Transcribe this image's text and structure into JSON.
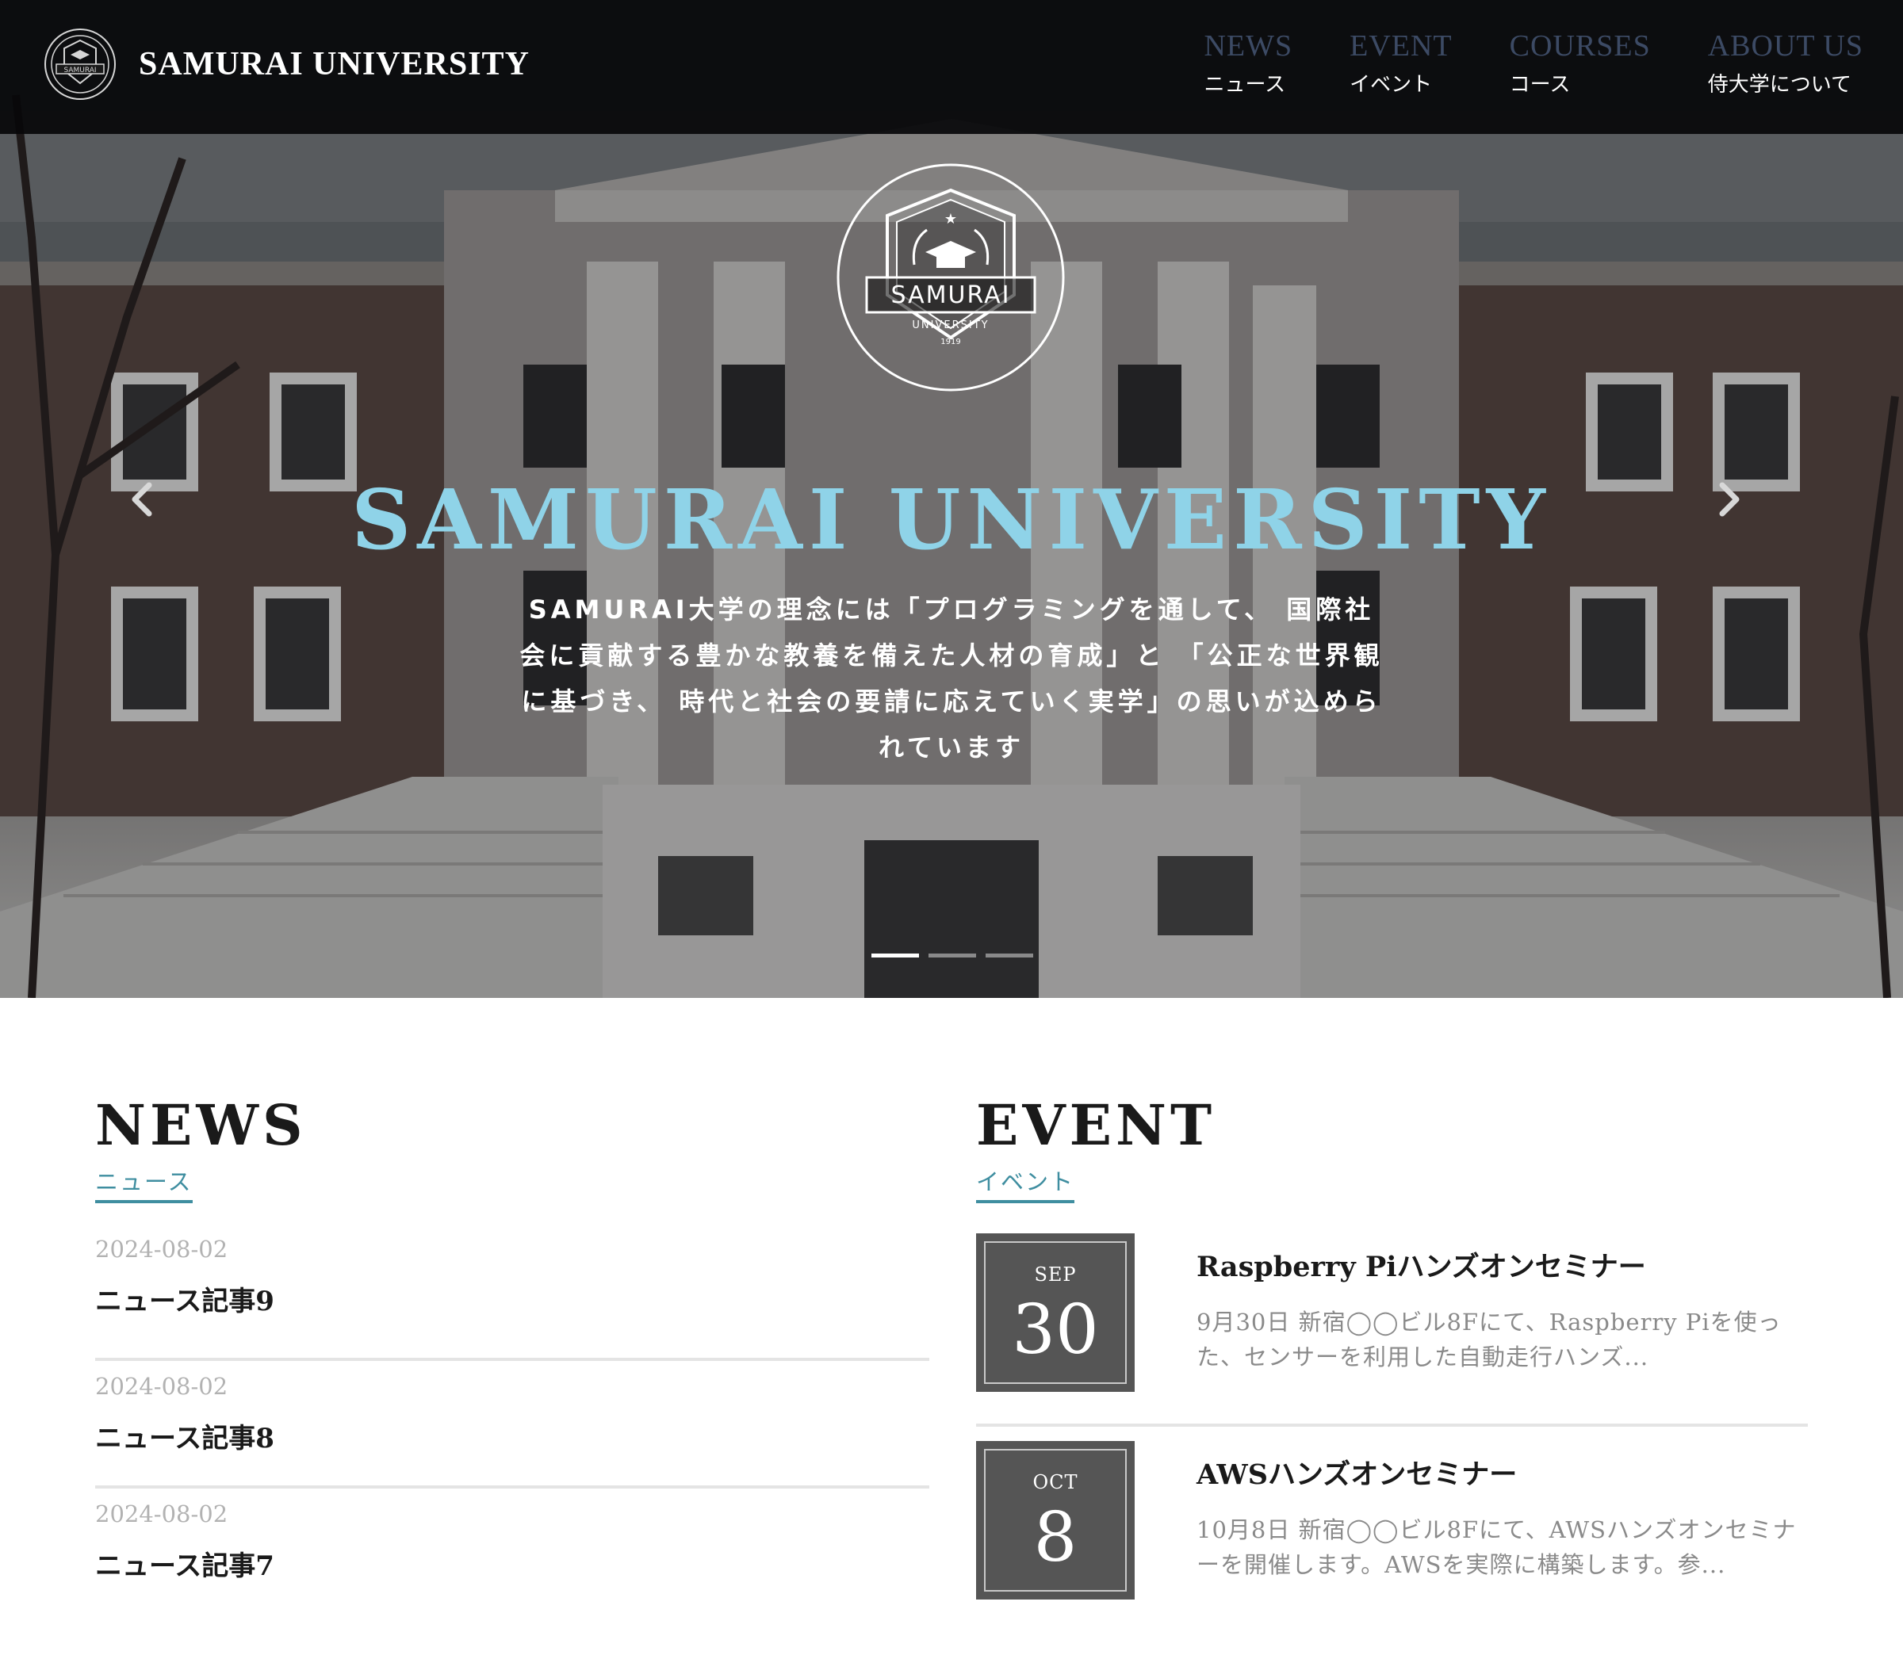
{
  "colors": {
    "nav_bg": "#08080a",
    "nav_link_en": "#3c4a64",
    "hero_title": "#8fd3e8",
    "accent": "#3f8ea0",
    "date_box": "#555555"
  },
  "header": {
    "brand_name": "SAMURAI UNIVERSITY",
    "logo_text": "SAMURAI",
    "nav": [
      {
        "en": "NEWS",
        "jp": "ニュース"
      },
      {
        "en": "EVENT",
        "jp": "イベント"
      },
      {
        "en": "COURSES",
        "jp": "コース"
      },
      {
        "en": "ABOUT US",
        "jp": "侍大学について"
      }
    ]
  },
  "hero": {
    "emblem": {
      "banner": "SAMURAI",
      "sub": "UNIVERSITY",
      "year": "1919"
    },
    "title": "SAMURAI UNIVERSITY",
    "text": "SAMURAI大学の理念には「プログラミングを通して、 国際社会に貢献する豊かな教養を備えた人材の育成」と 「公正な世界観に基づき、 時代と社会の要請に応えていく実学」の思いが込められています",
    "prev_icon": "chevron-left-icon",
    "next_icon": "chevron-right-icon",
    "slide_count": 3,
    "active_slide": 1
  },
  "news": {
    "title": "NEWS",
    "subtitle": "ニュース",
    "items": [
      {
        "date": "2024-08-02",
        "title": "ニュース記事9"
      },
      {
        "date": "2024-08-02",
        "title": "ニュース記事8"
      },
      {
        "date": "2024-08-02",
        "title": "ニュース記事7"
      }
    ]
  },
  "event": {
    "title": "EVENT",
    "subtitle": "イベント",
    "items": [
      {
        "month": "SEP",
        "day": "30",
        "title": "Raspberry Piハンズオンセミナー",
        "desc": "9月30日 新宿◯◯ビル8Fにて、Raspberry Piを使った、センサーを利用した自動走行ハンズ..."
      },
      {
        "month": "OCT",
        "day": "8",
        "title": "AWSハンズオンセミナー",
        "desc": "10月8日 新宿◯◯ビル8Fにて、AWSハンズオンセミナーを開催します。AWSを実際に構築します。参..."
      }
    ]
  }
}
